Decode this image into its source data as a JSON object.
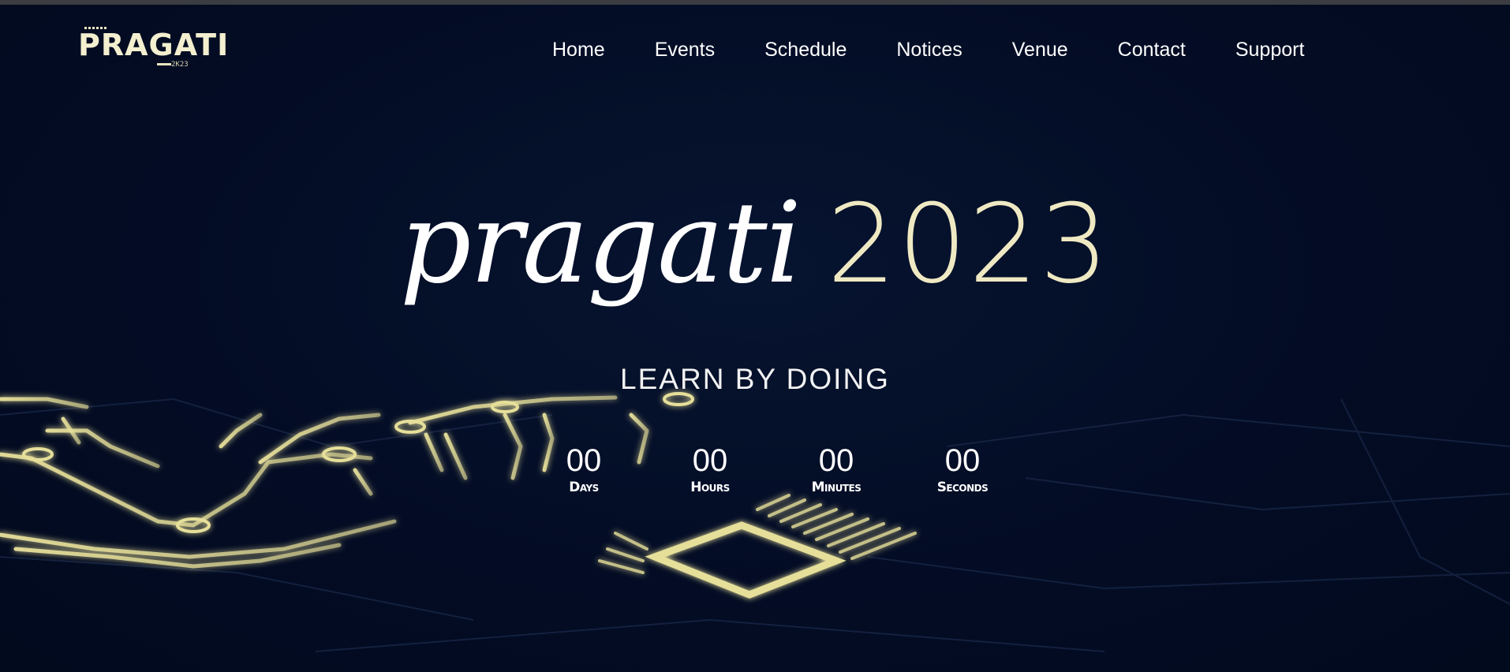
{
  "brand": {
    "logo_text": "PRAGATI",
    "logo_sub": "2K23"
  },
  "nav": {
    "items": [
      "Home",
      "Events",
      "Schedule",
      "Notices",
      "Venue",
      "Contact",
      "Support"
    ]
  },
  "hero": {
    "title_word": "pragati",
    "title_year": "2023",
    "tagline": "LEARN BY DOING"
  },
  "countdown": {
    "days": "00",
    "days_label": "Days",
    "hours": "00",
    "hours_label": "Hours",
    "minutes": "00",
    "minutes_label": "Minutes",
    "seconds": "00",
    "seconds_label": "Seconds"
  },
  "colors": {
    "background": "#020b22",
    "accent_cream": "#efe9c3",
    "circuit_glow": "#e6df9a"
  }
}
